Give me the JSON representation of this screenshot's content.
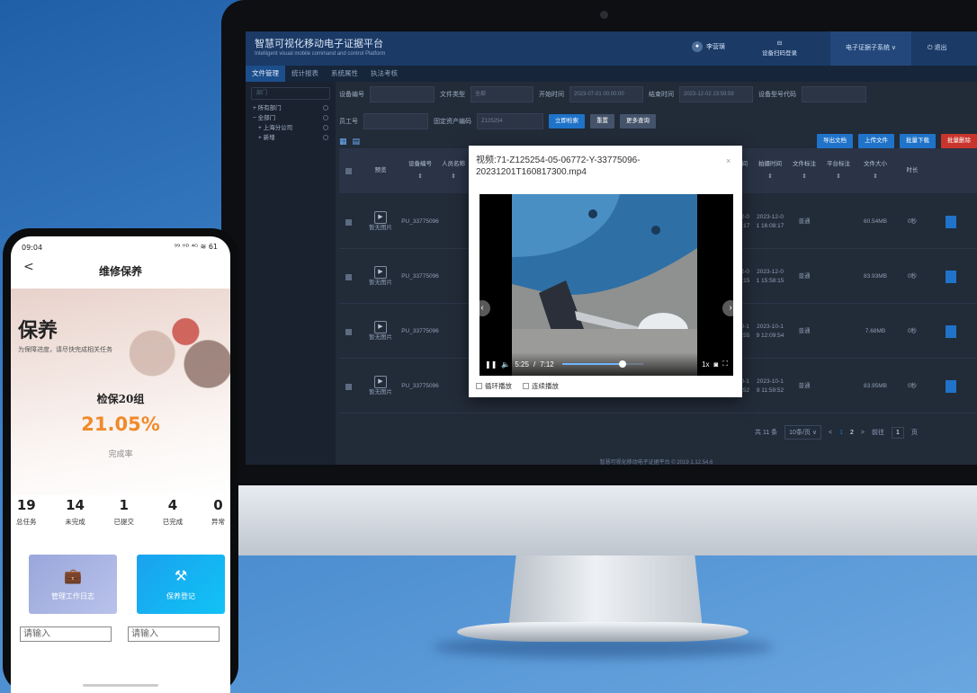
{
  "desktop": {
    "app_title": "智慧可视化移动电子证据平台",
    "app_subtitle": "Intelligent visual mobile command and control Platform",
    "user_name": "李营璜",
    "device_login": "设备扫码登录",
    "subsystem": "电子证据子系统 ∨",
    "logout": "退出",
    "nav": [
      "文件管理",
      "统计报表",
      "系统属性",
      "执法考核"
    ],
    "sidebar": {
      "search_placeholder": "部门",
      "tree": [
        "+ 所有部门",
        "− 全部门",
        "+ 上海分公司",
        "+ 新增"
      ]
    },
    "filters": {
      "device_no_label": "设备编号",
      "file_type_label": "文件类型",
      "file_type_value": "全部",
      "start_label": "开始时间",
      "start_value": "2023-07-01 00:00:00",
      "end_label": "结束时间",
      "end_value": "2023-12-02 23:59:59",
      "device_code_label": "设备型号代码",
      "staff_label": "员工号",
      "asset_label": "固定资产编码",
      "asset_value": "Z125254",
      "btn_search": "立即检索",
      "btn_reset": "重置",
      "btn_more": "更多查询"
    },
    "actions": [
      "导出文档",
      "上传文件",
      "批量下载",
      "批量删除"
    ],
    "table": {
      "headers": [
        "预览",
        "设备编号",
        "人员名称",
        "拍摄时间",
        "拍摄时间",
        "文件标注",
        "平台标注",
        "文件大小",
        "时长"
      ],
      "rows": [
        {
          "preview": "暂无图片",
          "device": "PU_33775096",
          "t1": "2023-12-0 1 16:08:17",
          "t2": "2023-12-0 1 16:08:17",
          "mark": "普通",
          "size": "60.54MB",
          "dur": "0秒"
        },
        {
          "preview": "暂无图片",
          "device": "PU_33775096",
          "t1": "2023-12-0 1 15:58:15",
          "t2": "2023-12-0 1 15:58:15",
          "mark": "普通",
          "size": "83.93MB",
          "dur": "0秒"
        },
        {
          "preview": "暂无图片",
          "device": "PU_33775096",
          "t1": "2023-10-1 9 12:09:55",
          "t2": "2023-10-1 9 12:09:54",
          "mark": "普通",
          "size": "7.68MB",
          "dur": "0秒"
        },
        {
          "preview": "暂无图片",
          "device": "PU_33775096",
          "t1": "2023-10-1 9 11:59:52",
          "t2": "2023-10-1 9 11:59:52",
          "mark": "普通",
          "size": "83.95MB",
          "dur": "0秒"
        }
      ]
    },
    "pager": {
      "total": "共 11 条",
      "per_page": "10条/页 ∨",
      "prev": "<",
      "page1": "1",
      "page2": "2",
      "next": ">",
      "goto": "前往",
      "page_input": "1",
      "page_unit": "页"
    },
    "footer": "智慧可视化移动电子证据平台 © 2019 1.12.54.6",
    "video_modal": {
      "title": "视频:71-Z125254-05-06772-Y-33775096-20231201T160817300.mp4",
      "close": "×",
      "current_time": "5:25",
      "total_time": "7:12",
      "progress": 0.75,
      "speed": "1x",
      "loop": "循环播放",
      "continuous": "连续播放"
    }
  },
  "phone": {
    "time": "09:04",
    "status_icons": "⁹⁹ ᴴᴰ ⁴ᴳ ≋ 61",
    "back": "<",
    "title": "维修保养",
    "big_title": "保养",
    "subtitle": "为保障进度，请尽快完成相关任务",
    "inspect_label": "检保20组",
    "completion_pct": "21.05%",
    "completion_label": "完成率",
    "stats": [
      {
        "value": "19",
        "label": "总任务"
      },
      {
        "value": "14",
        "label": "未完成"
      },
      {
        "value": "1",
        "label": "已提交"
      },
      {
        "value": "4",
        "label": "已完成"
      },
      {
        "value": "0",
        "label": "异常"
      }
    ],
    "cards": [
      {
        "label": "管理工作日志",
        "icon": "briefcase-icon"
      },
      {
        "label": "保养登记",
        "icon": "tools-icon"
      }
    ],
    "input_placeholder": "请输入"
  }
}
